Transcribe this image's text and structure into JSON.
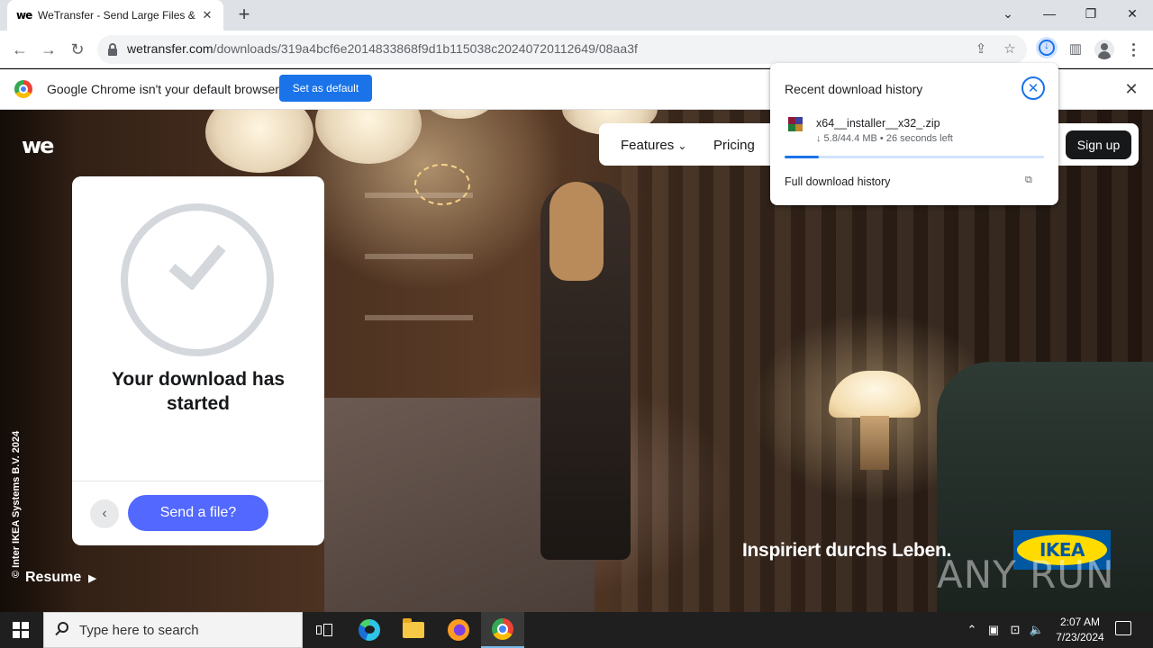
{
  "browser": {
    "tab_title": "WeTransfer - Send Large Files & ",
    "tab_favicon": "we",
    "url_host": "wetransfer.com",
    "url_path": "/downloads/319a4bcf6e2014833868f9d1b115038c20240720112649/08aa3f",
    "new_tab": "+",
    "infobar": {
      "text": "Google Chrome isn't your default browser",
      "button": "Set as default"
    }
  },
  "site": {
    "logo": "we",
    "nav": {
      "features": "Features",
      "features_caret": "⌄",
      "pricing": "Pricing",
      "signup": "Sign up"
    },
    "card": {
      "title": "Your download has started",
      "send_button": "Send a file?",
      "back": "‹"
    },
    "copyright": "© Inter IKEA Systems B.V. 2024",
    "resume": "Resume",
    "ad_tagline": "Inspiriert durchs Leben.",
    "ad_brand": "IKEA",
    "watermark": "ANY RUN"
  },
  "download_panel": {
    "title": "Recent download history",
    "file_name": "x64__installer__x32_.zip",
    "status": "↓ 5.8/44.4 MB • 26 seconds left",
    "progress_fraction": 0.131,
    "full_history": "Full download history"
  },
  "taskbar": {
    "search_placeholder": "Type here to search",
    "time": "2:07 AM",
    "date": "7/23/2024"
  },
  "colors": {
    "accent": "#1a73e8",
    "wetransfer_blue": "#5268ff",
    "ikea_blue": "#0058a3",
    "ikea_yellow": "#ffdb00"
  },
  "icons": [
    "close-icon",
    "chevron-down-icon",
    "minimize-icon",
    "restore-icon",
    "back-arrow-icon",
    "forward-arrow-icon",
    "reload-icon",
    "lock-icon",
    "share-icon",
    "star-icon",
    "download-icon",
    "side-panel-icon",
    "profile-icon",
    "menu-icon",
    "chrome-icon",
    "check-icon",
    "external-link-icon",
    "zip-file-icon",
    "windows-start-icon",
    "search-icon",
    "task-view-icon",
    "edge-icon",
    "file-explorer-icon",
    "firefox-icon",
    "network-icon",
    "volume-icon",
    "notification-icon"
  ]
}
